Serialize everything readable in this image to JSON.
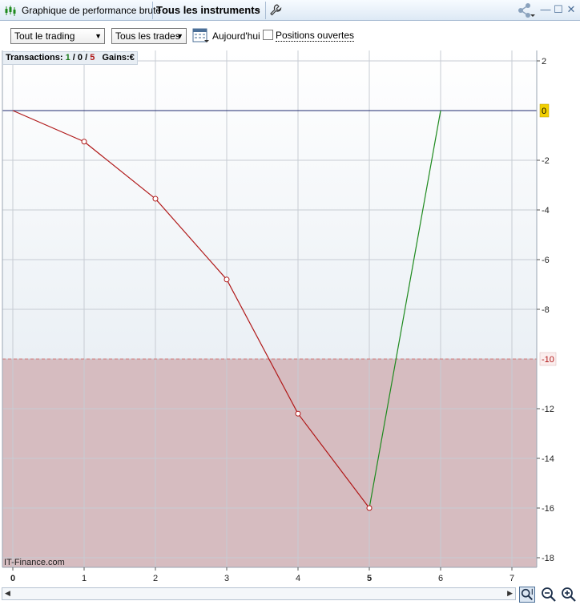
{
  "window": {
    "title": "Graphique de performance brute",
    "instrument_selector": "Tous les instruments"
  },
  "toolbar": {
    "period_select": "Tout le trading",
    "trades_select": "Tous les trades",
    "today_label": "Aujourd'hui",
    "open_positions_label": "Positions ouvertes",
    "open_positions_checked": false
  },
  "info": {
    "transactions_label": "Transactions:",
    "count_win": "1",
    "sep1": " / ",
    "count_neutral": "0",
    "sep2": " / ",
    "count_loss": "5",
    "gains_label": "Gains:",
    "gains_currency": "€"
  },
  "watermark": "IT-Finance.com",
  "colors": {
    "loss_line": "#b01818",
    "gain_line": "#1e8a1e",
    "zero_line": "#1f2a6e",
    "danger_zone": "#d6bcc0",
    "zero_marker": "#f2d000"
  },
  "chart_data": {
    "type": "line",
    "x_ticks": [
      "0",
      "1",
      "2",
      "3",
      "4",
      "5",
      "6",
      "7"
    ],
    "y_ticks": [
      "2",
      "-2",
      "-4",
      "-6",
      "-8",
      "-12",
      "-14",
      "-16",
      "-18"
    ],
    "xlim": [
      0,
      7.3
    ],
    "ylim": [
      -18.4,
      2.2
    ],
    "zero_marker_label": "0",
    "threshold": {
      "value": -10,
      "label": "-10"
    },
    "x": [
      0,
      1,
      2,
      3,
      4,
      5,
      6
    ],
    "y": [
      0,
      -1.25,
      -3.55,
      -6.8,
      -12.2,
      -16,
      0
    ],
    "segment_colors": [
      "loss",
      "loss",
      "loss",
      "loss",
      "loss",
      "gain"
    ]
  }
}
